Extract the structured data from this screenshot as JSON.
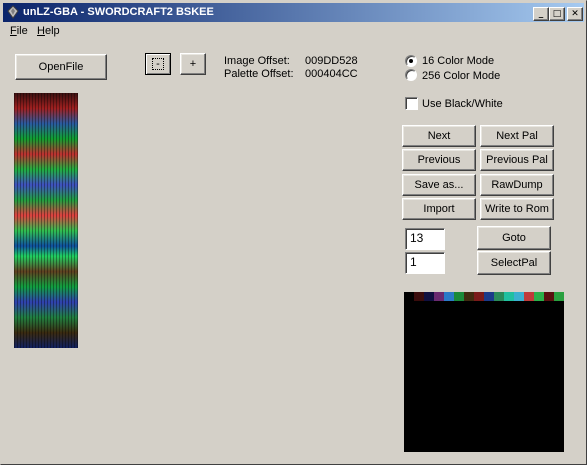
{
  "window": {
    "title": "unLZ-GBA - SWORDCRAFT2 BSKEE"
  },
  "menu": [
    {
      "label": "File",
      "mnemonic": "F",
      "rest": "ile"
    },
    {
      "label": "Help",
      "mnemonic": "H",
      "rest": "elp"
    }
  ],
  "toolbar": {
    "openfile_label": "OpenFile",
    "minus_label": "-",
    "plus_label": "+"
  },
  "offsets": {
    "image_label": "Image Offset:",
    "image_value": "009DD528",
    "palette_label": "Palette Offset:",
    "palette_value": "000404CC"
  },
  "color_mode": {
    "option_16": "16 Color Mode",
    "option_256": "256 Color Mode",
    "selected": "16 Color Mode"
  },
  "black_white": {
    "label": "Use Black/White",
    "checked": false
  },
  "buttons": {
    "next": "Next",
    "next_pal": "Next Pal",
    "previous": "Previous",
    "previous_pal": "Previous Pal",
    "save_as": "Save as...",
    "rawdump": "RawDump",
    "import": "Import",
    "write_to_rom": "Write to Rom",
    "goto": "Goto",
    "selectpal": "SelectPal"
  },
  "fields": {
    "goto_value": "13",
    "selectpal_value": "1"
  },
  "palette_colors": [
    "#000000",
    "#3a0c0c",
    "#101040",
    "#6a2a70",
    "#2a7ac8",
    "#1a8a3a",
    "#402a10",
    "#7a1a1a",
    "#1a3a8a",
    "#2a8a5a",
    "#20c0a0",
    "#3ab0d0",
    "#c03a3a",
    "#2ab04a",
    "#5a1010",
    "#2aa040"
  ]
}
